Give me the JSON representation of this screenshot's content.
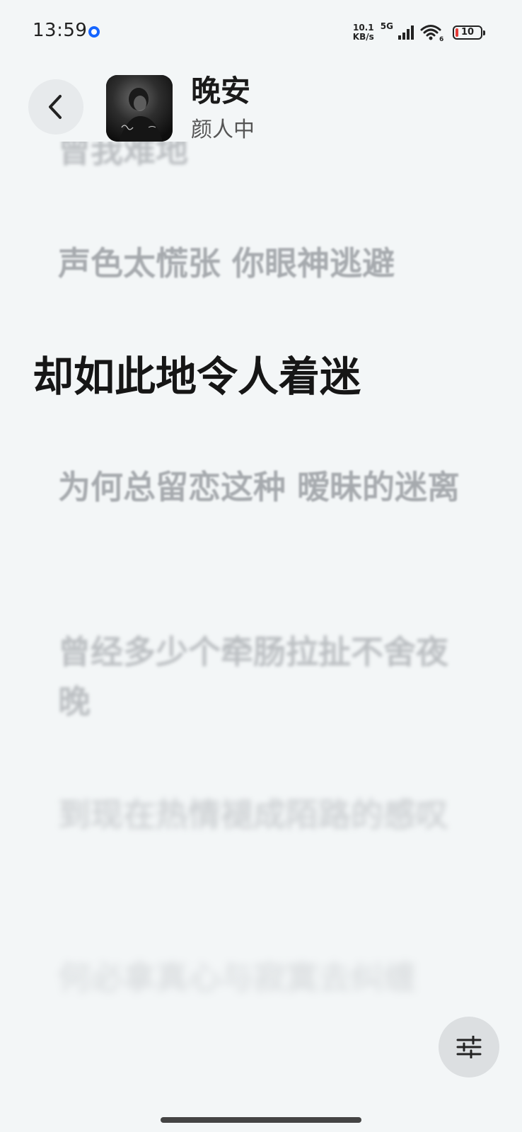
{
  "status_bar": {
    "time": "13:59",
    "net_speed_value": "10.1",
    "net_speed_unit": "KB/s",
    "network_type": "5G",
    "wifi_badge": "6",
    "battery_level": "10"
  },
  "header": {
    "song_title": "晚安",
    "artist": "颜人中"
  },
  "lyrics": {
    "prev_partial": "曾我难地",
    "lines": [
      "声色太慌张 你眼神逃避",
      "却如此地令人着迷",
      "为何总留恋这种 暧昧的迷离",
      "曾经多少个牵肠拉扯不舍夜晚",
      "到现在热情褪成陌路的感叹",
      "何必拿真心与寂寞去纠缠"
    ],
    "active_index": 1
  },
  "icons": {
    "back": "chevron-left-icon",
    "adjust": "sliders-icon",
    "status_dot": "record-icon"
  },
  "colors": {
    "background": "#f3f6f7",
    "active_lyric": "#161616",
    "inactive_lyric": "#8d9196",
    "accent": "#1565ff"
  }
}
